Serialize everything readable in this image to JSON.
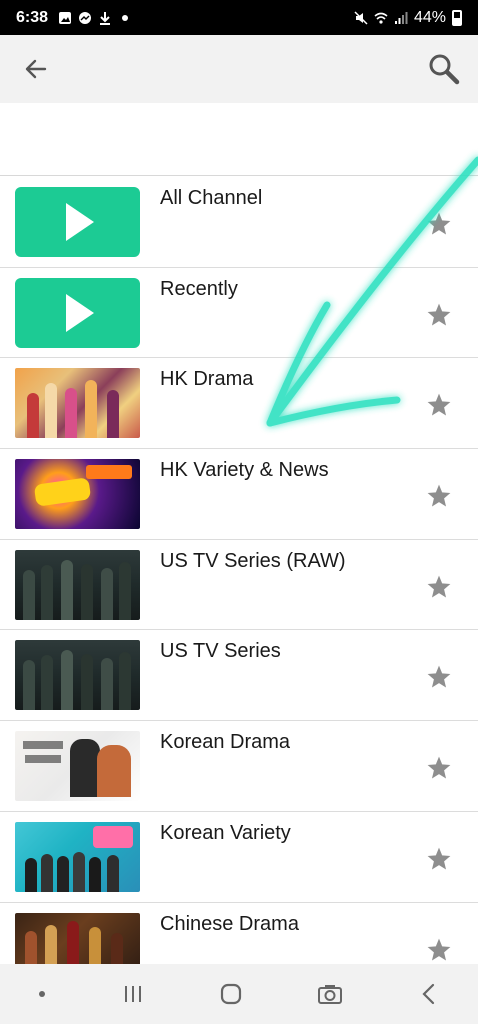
{
  "status_bar": {
    "time": "6:38",
    "battery": "44%"
  },
  "toolbar": {
    "back_icon": "arrow-left-icon",
    "search_icon": "search-icon"
  },
  "channels": [
    {
      "title": "All Channel",
      "thumb": "play"
    },
    {
      "title": "Recently",
      "thumb": "play"
    },
    {
      "title": "HK Drama",
      "thumb": "hkdrama"
    },
    {
      "title": "HK Variety & News",
      "thumb": "variety"
    },
    {
      "title": "US TV Series (RAW)",
      "thumb": "us"
    },
    {
      "title": "US TV Series",
      "thumb": "us"
    },
    {
      "title": "Korean Drama",
      "thumb": "korean"
    },
    {
      "title": "Korean Variety",
      "thumb": "kvariety"
    },
    {
      "title": "Chinese Drama",
      "thumb": "chinese"
    }
  ],
  "colors": {
    "accent_green": "#1ccb94",
    "star_gray": "#8e8e8e",
    "swoosh": "#2ee0c0"
  }
}
